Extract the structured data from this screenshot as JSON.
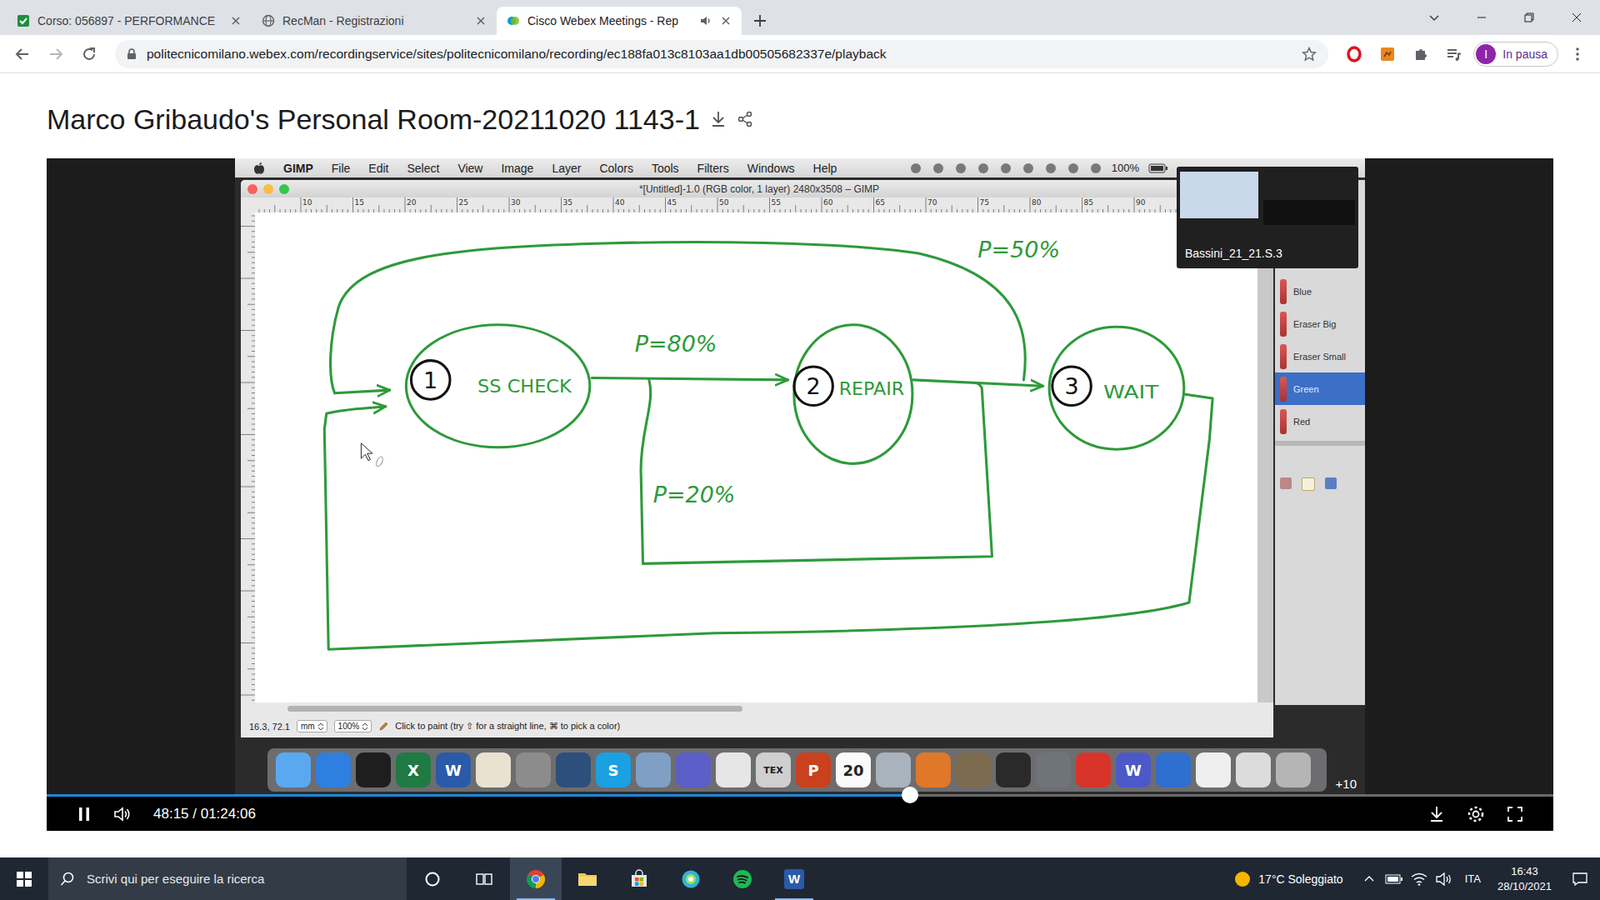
{
  "browser": {
    "tabs": [
      {
        "label": "Corso: 056897 - PERFORMANCE",
        "kind": "check",
        "selected": false,
        "audible": false
      },
      {
        "label": "RecMan - Registrazioni",
        "kind": "globe",
        "selected": false,
        "audible": false
      },
      {
        "label": "Cisco Webex Meetings - Rep",
        "kind": "webex",
        "selected": true,
        "audible": true
      }
    ],
    "url": "politecnicomilano.webex.com/recordingservice/sites/politecnicomilano/recording/ec188fa013c8103aa1db00505682337e/playback",
    "profile": {
      "initial": "I",
      "status": "In pausa"
    }
  },
  "page": {
    "title": "Marco Gribaudo's Personal Room-20211020 1143-1"
  },
  "player": {
    "playing": true,
    "time": "48:15 / 01:24:06",
    "level": 0.573
  },
  "mac": {
    "menu": [
      "GIMP",
      "File",
      "Edit",
      "Select",
      "View",
      "Image",
      "Layer",
      "Colors",
      "Tools",
      "Filters",
      "Windows",
      "Help"
    ],
    "battery": "100%",
    "overlay_badge": "+10",
    "participant": "Bassini_21_21.S.3",
    "dock": [
      {
        "color": "#5aa9f0",
        "glyph": ""
      },
      {
        "color": "#2f7fe0",
        "glyph": ""
      },
      {
        "color": "#1e1e1e",
        "glyph": ""
      },
      {
        "color": "#1f7a44",
        "glyph": "X"
      },
      {
        "color": "#2b5aa8",
        "glyph": "W"
      },
      {
        "color": "#e9e2d0",
        "glyph": ""
      },
      {
        "color": "#8c8c8c",
        "glyph": ""
      },
      {
        "color": "#2d4f7c",
        "glyph": ""
      },
      {
        "color": "#1ba0e2",
        "glyph": "S"
      },
      {
        "color": "#7f9fc4",
        "glyph": ""
      },
      {
        "color": "#5b5fc7",
        "glyph": ""
      },
      {
        "color": "#e6e6e6",
        "glyph": ""
      },
      {
        "color": "#cfcfcf",
        "glyph": "TEX"
      },
      {
        "color": "#c9411d",
        "glyph": "P"
      },
      {
        "color": "#fafafa",
        "glyph": "20"
      },
      {
        "color": "#a9b3bd",
        "glyph": ""
      },
      {
        "color": "#e0782a",
        "glyph": ""
      },
      {
        "color": "#7d6b4f",
        "glyph": ""
      },
      {
        "color": "#2a2a2a",
        "glyph": ""
      },
      {
        "color": "#6f7478",
        "glyph": ""
      },
      {
        "color": "#d8342a",
        "glyph": ""
      },
      {
        "color": "#4b59c9",
        "glyph": "W"
      },
      {
        "color": "#2f6fd0",
        "glyph": ""
      },
      {
        "color": "#efefef",
        "glyph": ""
      },
      {
        "color": "#dcdcdc",
        "glyph": ""
      },
      {
        "color": "#b5b5b5",
        "glyph": ""
      }
    ]
  },
  "gimp": {
    "title": "*[Untitled]-1.0 (RGB color, 1 layer) 2480x3508 – GIMP",
    "ruler": [
      "10",
      "15",
      "20",
      "25",
      "30",
      "35",
      "40",
      "45",
      "50",
      "55",
      "60",
      "65",
      "70",
      "75",
      "80",
      "85",
      "90"
    ],
    "status": {
      "coords": "16.3, 72.1",
      "unit": "mm",
      "zoom": "100%",
      "hint": "Click to paint (try ⇧ for a straight line, ⌘ to pick a color)"
    },
    "brushes": [
      {
        "label": "Blue",
        "selected": false
      },
      {
        "label": "Eraser Big",
        "selected": false
      },
      {
        "label": "Eraser Small",
        "selected": false
      },
      {
        "label": "Green",
        "selected": true
      },
      {
        "label": "Red",
        "selected": false
      }
    ]
  },
  "diagram": {
    "nodes": [
      {
        "number": "1",
        "label": "SS CHECK"
      },
      {
        "number": "2",
        "label": "REPAIR"
      },
      {
        "number": "3",
        "label": "WAIT"
      }
    ],
    "edges": [
      {
        "from": "1",
        "to": "2",
        "label": "P=80%"
      },
      {
        "from": "1",
        "to": "3",
        "label": "P=20%"
      },
      {
        "from": "2",
        "to": "1",
        "label": "P=50%"
      },
      {
        "from": "2",
        "to": "3",
        "label": ""
      },
      {
        "from": "3",
        "to": "1",
        "label": ""
      }
    ]
  },
  "taskbar": {
    "search": "Scrivi qui per eseguire la ricerca",
    "apps": [
      {
        "kind": "chrome",
        "selected": true,
        "running": true,
        "glyph": ""
      },
      {
        "kind": "explorer",
        "selected": false,
        "running": false,
        "glyph": ""
      },
      {
        "kind": "store",
        "selected": false,
        "running": false,
        "glyph": ""
      },
      {
        "kind": "browser",
        "selected": false,
        "running": false,
        "glyph": ""
      },
      {
        "kind": "spotify",
        "selected": false,
        "running": false,
        "glyph": ""
      },
      {
        "kind": "word",
        "selected": false,
        "running": true,
        "glyph": "W"
      }
    ],
    "weather": "17°C Soleggiato",
    "language": "ITA",
    "time": "16:43",
    "date": "28/10/2021"
  }
}
